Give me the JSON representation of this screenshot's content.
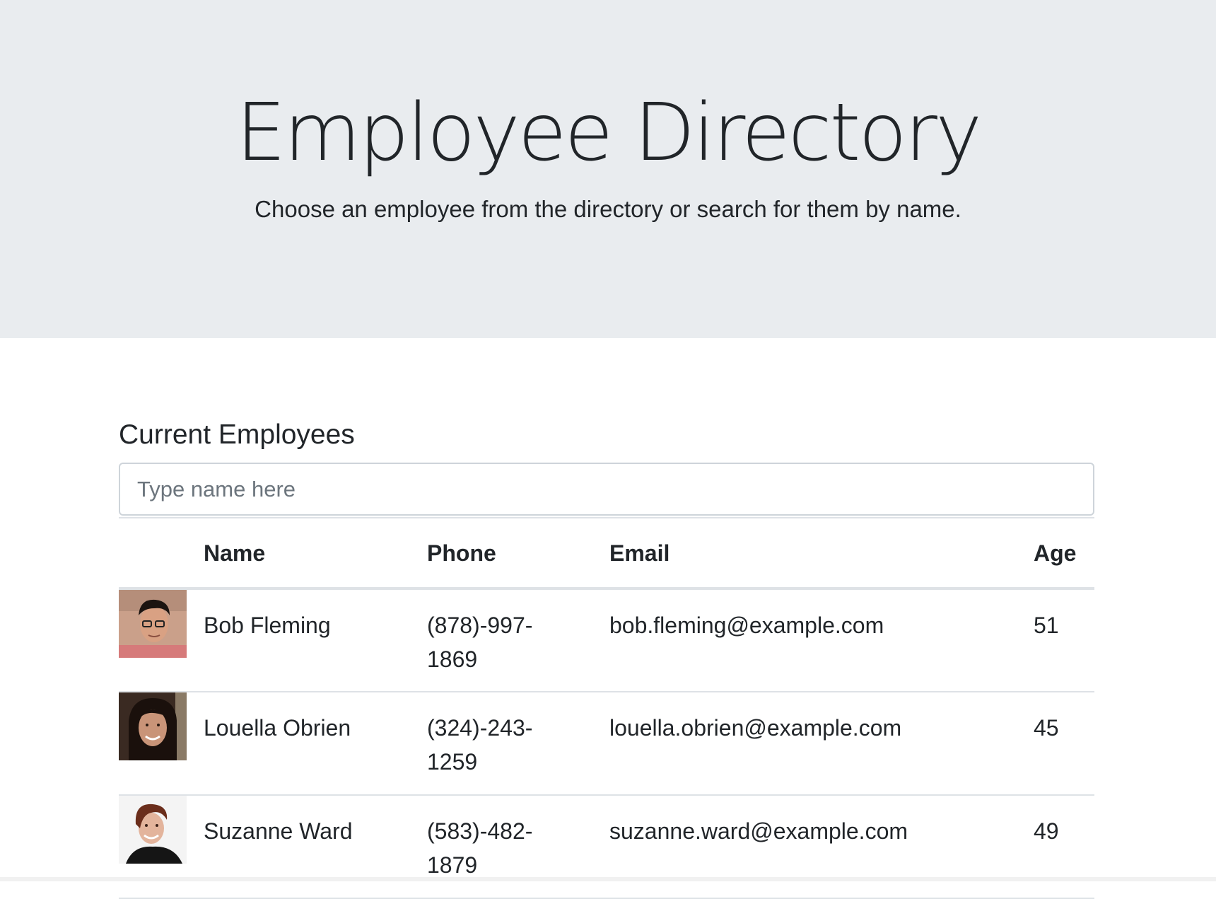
{
  "header": {
    "title": "Employee Directory",
    "subtitle": "Choose an employee from the directory or search for them by name."
  },
  "main": {
    "section_title": "Current Employees",
    "search": {
      "placeholder": "Type name here",
      "value": ""
    },
    "table": {
      "columns": [
        "",
        "Name",
        "Phone",
        "Email",
        "Age"
      ],
      "rows": [
        {
          "photo_icon": "avatar-photo",
          "name": "Bob Fleming",
          "phone": "(878)-997-1869",
          "email": "bob.fleming@example.com",
          "age": "51"
        },
        {
          "photo_icon": "avatar-photo",
          "name": "Louella Obrien",
          "phone": "(324)-243-1259",
          "email": "louella.obrien@example.com",
          "age": "45"
        },
        {
          "photo_icon": "avatar-photo",
          "name": "Suzanne Ward",
          "phone": "(583)-482-1879",
          "email": "suzanne.ward@example.com",
          "age": "49"
        }
      ]
    }
  },
  "colors": {
    "jumbotron_bg": "#e9ecef",
    "text": "#212529",
    "border": "#dee2e6",
    "placeholder": "#6c757d"
  }
}
